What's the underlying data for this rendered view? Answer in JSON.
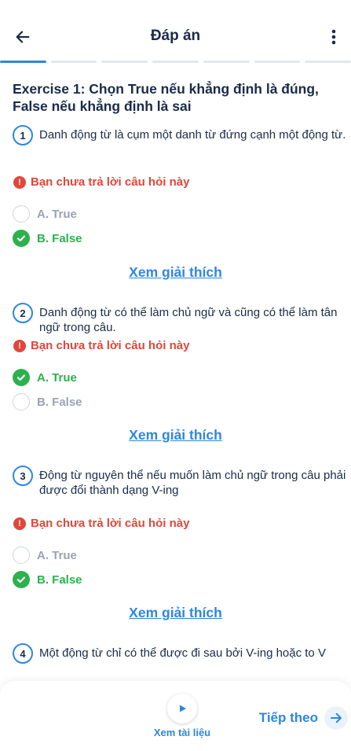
{
  "header": {
    "title": "Đáp án",
    "back_icon": "arrow-left-icon",
    "more_icon": "more-vertical-icon"
  },
  "progress": {
    "segments": 7,
    "active_index": 0
  },
  "exercise": {
    "title": "Exercise 1: Chọn True nếu khẳng định là đúng, False nếu khẳng định là sai"
  },
  "questions": [
    {
      "number": "1",
      "text": "Danh động từ là cụm một danh từ đứng cạnh một động từ.",
      "warning": "Bạn chưa trả lời câu hỏi này",
      "options": [
        {
          "label": "A. True",
          "correct": false
        },
        {
          "label": "B. False",
          "correct": true
        }
      ],
      "explain": "Xem giải thích"
    },
    {
      "number": "2",
      "text": "Danh động từ có thể làm chủ ngữ và cũng có thể làm tân ngữ trong câu.",
      "warning": "Bạn chưa trả lời câu hỏi này",
      "options": [
        {
          "label": "A. True",
          "correct": true
        },
        {
          "label": "B. False",
          "correct": false
        }
      ],
      "explain": "Xem giải thích"
    },
    {
      "number": "3",
      "text": "Động từ nguyên thể nếu muốn làm chủ ngữ trong câu phải được đổi thành dạng V-ing",
      "warning": "Bạn chưa trả lời câu hỏi này",
      "options": [
        {
          "label": "A. True",
          "correct": false
        },
        {
          "label": "B. False",
          "correct": true
        }
      ],
      "explain": "Xem giải thích"
    },
    {
      "number": "4",
      "text": "Một động từ chỉ có thể được đi sau bởi V-ing hoặc to V"
    }
  ],
  "bottom_bar": {
    "doc_label": "Xem tài liệu",
    "doc_icon": "play-icon",
    "next_label": "Tiếp theo",
    "next_icon": "arrow-right-icon"
  },
  "colors": {
    "primary": "#2f86e0",
    "correct": "#2bb24c",
    "warning": "#e0473a",
    "text": "#1a2b4a",
    "muted": "#9aa3b2"
  }
}
